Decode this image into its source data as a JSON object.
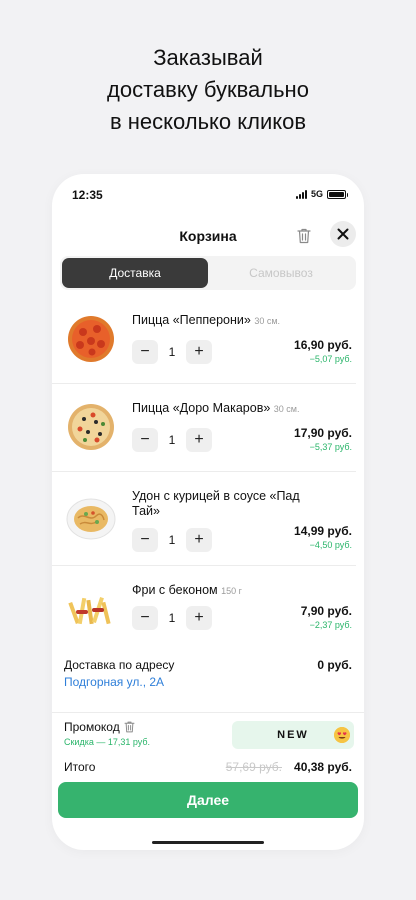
{
  "headline": [
    "Заказывай",
    "доставку буквально",
    "в несколько кликов"
  ],
  "status": {
    "time": "12:35",
    "network": "5G"
  },
  "header": {
    "title": "Корзина"
  },
  "tabs": [
    {
      "label": "Доставка",
      "active": true
    },
    {
      "label": "Самовывоз",
      "active": false
    }
  ],
  "items": [
    {
      "name": "Пицца «Пепперони»",
      "weight": "30 см.",
      "qty": "1",
      "price": "16,90 руб.",
      "discount": "−5,07 руб.",
      "icon": "pepperoni-pizza-image"
    },
    {
      "name": "Пицца «Доро Макаров»",
      "weight": "30 см.",
      "qty": "1",
      "price": "17,90 руб.",
      "discount": "−5,37 руб.",
      "icon": "doro-pizza-image"
    },
    {
      "name": "Удон с курицей в соусе «Пад Тай»",
      "weight": "",
      "qty": "1",
      "price": "14,99 руб.",
      "discount": "−4,50 руб.",
      "icon": "udon-image"
    },
    {
      "name": "Фри с беконом",
      "weight": "150 г",
      "qty": "1",
      "price": "7,90 руб.",
      "discount": "−2,37 руб.",
      "icon": "fries-image"
    }
  ],
  "stepper": {
    "minus": "−",
    "plus": "+"
  },
  "delivery": {
    "label": "Доставка по адресу",
    "address": "Подгорная ул., 2А",
    "price": "0 руб."
  },
  "promo": {
    "label": "Промокод",
    "discount": "Скидка — 17,31 руб.",
    "code": "NEW"
  },
  "total": {
    "label": "Итого",
    "old": "57,69 руб.",
    "new": "40,38 руб."
  },
  "next_button": "Далее",
  "colors": {
    "accent_green": "#36b36e",
    "link_blue": "#2f7fd9",
    "discount_green": "#2ab56a",
    "active_tab": "#3a3a3a"
  }
}
